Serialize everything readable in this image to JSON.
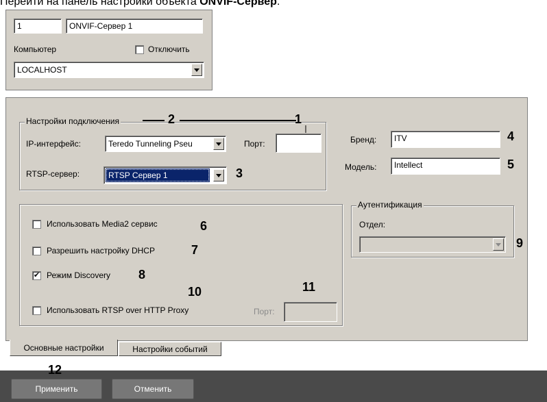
{
  "caption": {
    "prefix": "Перейти на панель настройки объекта ",
    "bold": "ONVIF-Сервер",
    "suffix": "."
  },
  "header": {
    "object_id": "1",
    "object_name": "ONVIF-Сервер 1",
    "computer_label": "Компьютер",
    "disable_label": "Отключить",
    "disable_checked": false,
    "computer_value": "LOCALHOST"
  },
  "connection": {
    "group_title": "Настройки подключения",
    "ip_label": "IP-интерфейс:",
    "ip_value": "Teredo Tunneling Pseu",
    "port_label": "Порт:",
    "port_value": "",
    "rtsp_label": "RTSP-сервер:",
    "rtsp_value": "RTSP Сервер 1",
    "brand_label": "Бренд:",
    "brand_value": "ITV",
    "model_label": "Модель:",
    "model_value": "Intellect"
  },
  "options": {
    "media2_label": "Использовать Media2 сервис",
    "media2_checked": false,
    "dhcp_label": "Разрешить настройку DHCP",
    "dhcp_checked": false,
    "discovery_label": "Режим Discovery",
    "discovery_checked": true,
    "rtsp_http_label": "Использовать RTSP over HTTP Proxy",
    "rtsp_http_checked": false,
    "proxy_port_label": "Порт:",
    "proxy_port_value": ""
  },
  "auth": {
    "group_title": "Аутентификация",
    "dept_label": "Отдел:",
    "dept_value": ""
  },
  "tabs": [
    "Основные настройки",
    "Настройки событий"
  ],
  "footer": {
    "apply_label": "Применить",
    "cancel_label": "Отменить"
  },
  "callouts": {
    "n1": "1",
    "n2": "2",
    "n3": "3",
    "n4": "4",
    "n5": "5",
    "n6": "6",
    "n7": "7",
    "n8": "8",
    "n9": "9",
    "n10": "10",
    "n11": "11",
    "n12": "12"
  }
}
